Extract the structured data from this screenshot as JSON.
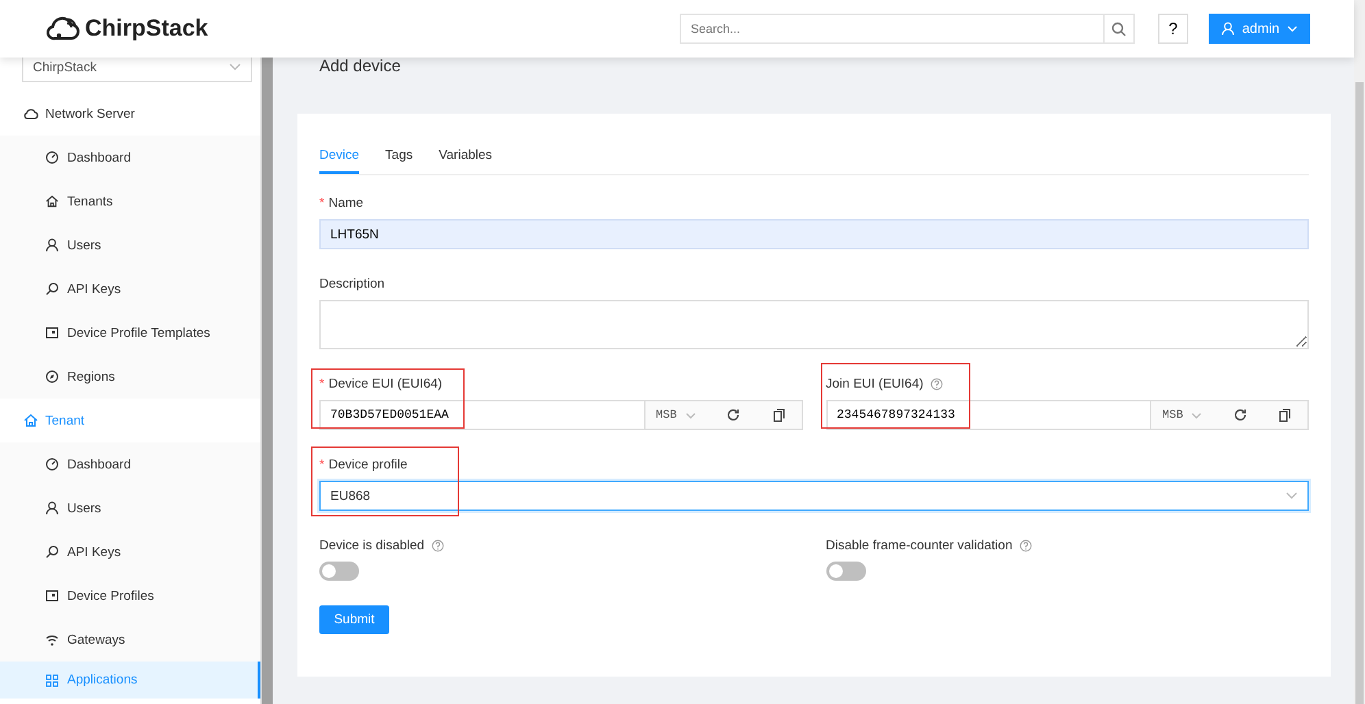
{
  "header": {
    "logo": "ChirpStack",
    "search": {
      "placeholder": "Search..."
    },
    "help_button": "?",
    "user_button": "admin"
  },
  "sidebar": {
    "tenant_select": "ChirpStack",
    "sections": [
      {
        "label": "Network Server",
        "kind": "cloud",
        "selected": false,
        "items": [
          {
            "label": "Dashboard",
            "kind": "dashboard",
            "selected": false
          },
          {
            "label": "Tenants",
            "kind": "home",
            "selected": false
          },
          {
            "label": "Users",
            "kind": "user",
            "selected": false
          },
          {
            "label": "API Keys",
            "kind": "key",
            "selected": false
          },
          {
            "label": "Device Profile Templates",
            "kind": "profile",
            "selected": false
          },
          {
            "label": "Regions",
            "kind": "compass",
            "selected": false
          }
        ]
      },
      {
        "label": "Tenant",
        "kind": "home",
        "selected": true,
        "items": [
          {
            "label": "Dashboard",
            "kind": "dashboard",
            "selected": false
          },
          {
            "label": "Users",
            "kind": "user",
            "selected": false
          },
          {
            "label": "API Keys",
            "kind": "key",
            "selected": false
          },
          {
            "label": "Device Profiles",
            "kind": "profile",
            "selected": false
          },
          {
            "label": "Gateways",
            "kind": "wifi",
            "selected": false
          },
          {
            "label": "Applications",
            "kind": "apps",
            "selected": true
          }
        ]
      }
    ]
  },
  "page": {
    "title": "Add device",
    "tabs": [
      {
        "label": "Device",
        "selected": true
      },
      {
        "label": "Tags",
        "selected": false
      },
      {
        "label": "Variables",
        "selected": false
      }
    ],
    "name": {
      "mark": "*",
      "label": "Name",
      "value": "LHT65N"
    },
    "description": {
      "label": "Description"
    },
    "device_eui": {
      "mark": "*",
      "label": "Device EUI (EUI64)",
      "value": "70B3D57ED0051EAA",
      "byte_order": "MSB",
      "highlighted": true
    },
    "join_eui": {
      "label": "Join EUI (EUI64)",
      "help": true,
      "value": "2345467897324133",
      "byte_order": "MSB",
      "highlighted": true
    },
    "device_profile": {
      "mark": "*",
      "label": "Device profile",
      "value": "EU868",
      "highlighted": true
    },
    "switches": [
      {
        "label": "Device is disabled",
        "on": false
      },
      {
        "label": "Disable frame-counter validation",
        "on": false
      }
    ],
    "submit": "Submit"
  }
}
